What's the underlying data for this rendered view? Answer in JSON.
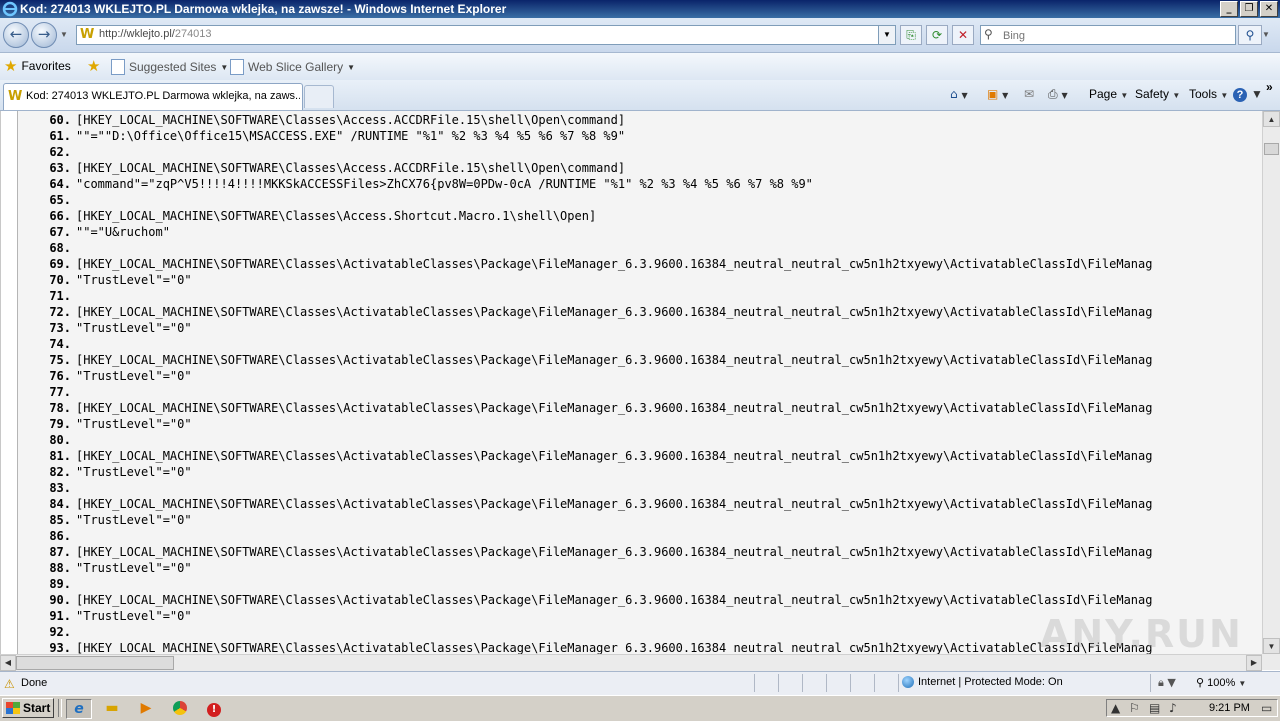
{
  "window": {
    "title": "Kod: 274013 WKLEJTO.PL Darmowa wklejka, na zawsze! - Windows Internet Explorer",
    "minimize": "_",
    "restore": "❐",
    "close": "✕"
  },
  "address": {
    "url_host": "http://wklejto.pl/",
    "url_path": "274013",
    "search_placeholder": "Bing"
  },
  "favorites_bar": {
    "favorites": "Favorites",
    "suggested_sites": "Suggested Sites",
    "web_slice_gallery": "Web Slice Gallery"
  },
  "tab": {
    "label": "Kod: 274013 WKLEJTO.PL Darmowa wklejka, na zaws..."
  },
  "command_bar": {
    "page": "Page",
    "safety": "Safety",
    "tools": "Tools",
    "help": "?"
  },
  "lines": [
    {
      "n": "60.",
      "text": "[HKEY_LOCAL_MACHINE\\SOFTWARE\\Classes\\Access.ACCDRFile.15\\shell\\Open\\command]"
    },
    {
      "n": "61.",
      "text": "\"\"=\"\"D:\\Office\\Office15\\MSACCESS.EXE\" /RUNTIME \"%1\" %2 %3 %4 %5 %6 %7 %8 %9\""
    },
    {
      "n": "62.",
      "text": ""
    },
    {
      "n": "63.",
      "text": "[HKEY_LOCAL_MACHINE\\SOFTWARE\\Classes\\Access.ACCDRFile.15\\shell\\Open\\command]"
    },
    {
      "n": "64.",
      "text": "\"command\"=\"zqP^V5!!!!4!!!!MKKSkACCESSFiles>ZhCX76{pv8W=0PDw-0cA /RUNTIME \"%1\" %2 %3 %4 %5 %6 %7 %8 %9\""
    },
    {
      "n": "65.",
      "text": ""
    },
    {
      "n": "66.",
      "text": "[HKEY_LOCAL_MACHINE\\SOFTWARE\\Classes\\Access.Shortcut.Macro.1\\shell\\Open]"
    },
    {
      "n": "67.",
      "text": "\"\"=\"U&ruchom\""
    },
    {
      "n": "68.",
      "text": ""
    },
    {
      "n": "69.",
      "text": "[HKEY_LOCAL_MACHINE\\SOFTWARE\\Classes\\ActivatableClasses\\Package\\FileManager_6.3.9600.16384_neutral_neutral_cw5n1h2txyewy\\ActivatableClassId\\FileManag"
    },
    {
      "n": "70.",
      "text": "\"TrustLevel\"=\"0\""
    },
    {
      "n": "71.",
      "text": ""
    },
    {
      "n": "72.",
      "text": "[HKEY_LOCAL_MACHINE\\SOFTWARE\\Classes\\ActivatableClasses\\Package\\FileManager_6.3.9600.16384_neutral_neutral_cw5n1h2txyewy\\ActivatableClassId\\FileManag"
    },
    {
      "n": "73.",
      "text": "\"TrustLevel\"=\"0\""
    },
    {
      "n": "74.",
      "text": ""
    },
    {
      "n": "75.",
      "text": "[HKEY_LOCAL_MACHINE\\SOFTWARE\\Classes\\ActivatableClasses\\Package\\FileManager_6.3.9600.16384_neutral_neutral_cw5n1h2txyewy\\ActivatableClassId\\FileManag"
    },
    {
      "n": "76.",
      "text": "\"TrustLevel\"=\"0\""
    },
    {
      "n": "77.",
      "text": ""
    },
    {
      "n": "78.",
      "text": "[HKEY_LOCAL_MACHINE\\SOFTWARE\\Classes\\ActivatableClasses\\Package\\FileManager_6.3.9600.16384_neutral_neutral_cw5n1h2txyewy\\ActivatableClassId\\FileManag"
    },
    {
      "n": "79.",
      "text": "\"TrustLevel\"=\"0\""
    },
    {
      "n": "80.",
      "text": ""
    },
    {
      "n": "81.",
      "text": "[HKEY_LOCAL_MACHINE\\SOFTWARE\\Classes\\ActivatableClasses\\Package\\FileManager_6.3.9600.16384_neutral_neutral_cw5n1h2txyewy\\ActivatableClassId\\FileManag"
    },
    {
      "n": "82.",
      "text": "\"TrustLevel\"=\"0\""
    },
    {
      "n": "83.",
      "text": ""
    },
    {
      "n": "84.",
      "text": "[HKEY_LOCAL_MACHINE\\SOFTWARE\\Classes\\ActivatableClasses\\Package\\FileManager_6.3.9600.16384_neutral_neutral_cw5n1h2txyewy\\ActivatableClassId\\FileManag"
    },
    {
      "n": "85.",
      "text": "\"TrustLevel\"=\"0\""
    },
    {
      "n": "86.",
      "text": ""
    },
    {
      "n": "87.",
      "text": "[HKEY_LOCAL_MACHINE\\SOFTWARE\\Classes\\ActivatableClasses\\Package\\FileManager_6.3.9600.16384_neutral_neutral_cw5n1h2txyewy\\ActivatableClassId\\FileManag"
    },
    {
      "n": "88.",
      "text": "\"TrustLevel\"=\"0\""
    },
    {
      "n": "89.",
      "text": ""
    },
    {
      "n": "90.",
      "text": "[HKEY_LOCAL_MACHINE\\SOFTWARE\\Classes\\ActivatableClasses\\Package\\FileManager_6.3.9600.16384_neutral_neutral_cw5n1h2txyewy\\ActivatableClassId\\FileManag"
    },
    {
      "n": "91.",
      "text": "\"TrustLevel\"=\"0\""
    },
    {
      "n": "92.",
      "text": ""
    },
    {
      "n": "93.",
      "text": "[HKEY_LOCAL_MACHINE\\SOFTWARE\\Classes\\ActivatableClasses\\Package\\FileManager_6.3.9600.16384_neutral_neutral_cw5n1h2txyewy\\ActivatableClassId\\FileManag"
    }
  ],
  "status": {
    "text": "Done",
    "zone": "Internet | Protected Mode: On",
    "zoom": "100%"
  },
  "taskbar": {
    "start": "Start",
    "clock": "9:21 PM"
  },
  "watermark": "ANY.RUN",
  "icons": {
    "back": "back-arrow-icon",
    "forward": "forward-arrow-icon",
    "refresh": "refresh-icon",
    "stop": "stop-icon",
    "search": "search-icon",
    "home": "home-icon",
    "feeds": "rss-feed-icon",
    "print": "printer-icon"
  },
  "colors": {
    "titlebar": "#0a246a",
    "content_bg": "#f4f4f4",
    "taskbar": "#d4d0c8"
  }
}
